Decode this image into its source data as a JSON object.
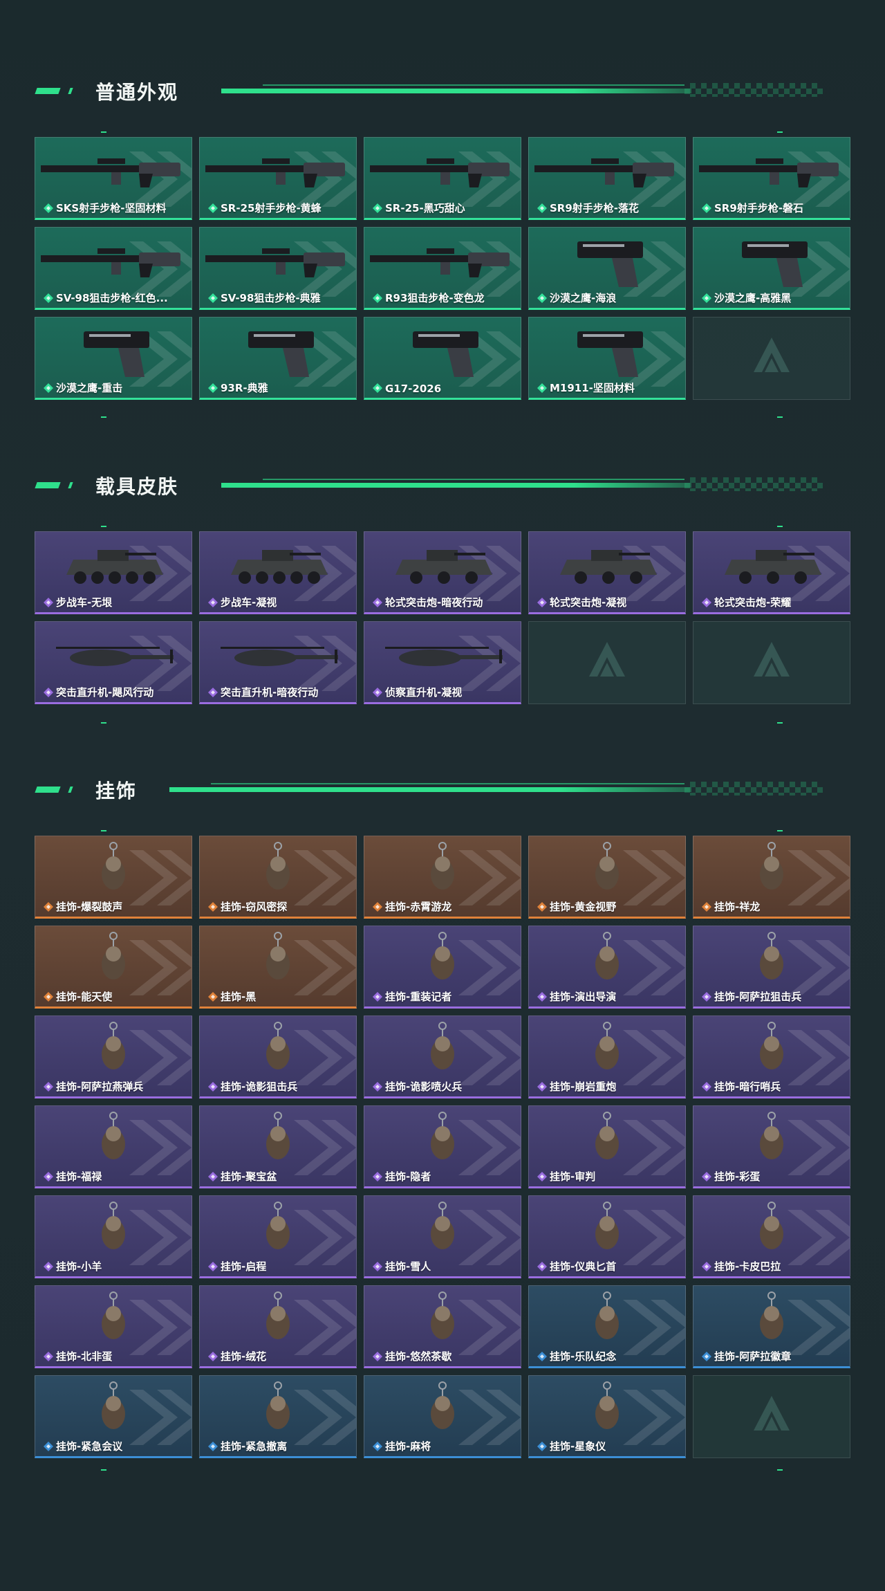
{
  "colors": {
    "accent": "#2fe08c",
    "green_rarity": "#33e29a",
    "purple_rarity": "#9a6de0",
    "orange_rarity": "#e0823a",
    "blue_rarity": "#3c8fd6"
  },
  "sections": [
    {
      "title": "普通外观",
      "items": [
        {
          "label": "SKS射手步枪-坚固材料",
          "rarity": "green",
          "icon": "rifle-icon"
        },
        {
          "label": "SR-25射手步枪-黄蜂",
          "rarity": "green",
          "icon": "rifle-icon"
        },
        {
          "label": "SR-25-黑巧甜心",
          "rarity": "green",
          "icon": "rifle-icon"
        },
        {
          "label": "SR9射手步枪-落花",
          "rarity": "green",
          "icon": "rifle-icon"
        },
        {
          "label": "SR9射手步枪-磐石",
          "rarity": "green",
          "icon": "rifle-icon"
        },
        {
          "label": "SV-98狙击步枪-红色...",
          "rarity": "green",
          "icon": "sniper-icon"
        },
        {
          "label": "SV-98狙击步枪-典雅",
          "rarity": "green",
          "icon": "sniper-icon"
        },
        {
          "label": "R93狙击步枪-变色龙",
          "rarity": "green",
          "icon": "sniper-icon"
        },
        {
          "label": "沙漠之鹰-海浪",
          "rarity": "green",
          "icon": "pistol-icon"
        },
        {
          "label": "沙漠之鹰-高雅黑",
          "rarity": "green",
          "icon": "pistol-icon"
        },
        {
          "label": "沙漠之鹰-重击",
          "rarity": "green",
          "icon": "pistol-icon"
        },
        {
          "label": "93R-典雅",
          "rarity": "green",
          "icon": "pistol-icon"
        },
        {
          "label": "G17-2026",
          "rarity": "green",
          "icon": "pistol-icon"
        },
        {
          "label": "M1911-坚固材料",
          "rarity": "green",
          "icon": "pistol-icon"
        },
        {
          "label": "",
          "rarity": "empty",
          "icon": "logo-icon"
        }
      ]
    },
    {
      "title": "载具皮肤",
      "items": [
        {
          "label": "步战车-无垠",
          "rarity": "purple",
          "icon": "ifv-icon"
        },
        {
          "label": "步战车-凝视",
          "rarity": "purple",
          "icon": "ifv-icon"
        },
        {
          "label": "轮式突击炮-暗夜行动",
          "rarity": "purple",
          "icon": "armored-car-icon"
        },
        {
          "label": "轮式突击炮-凝视",
          "rarity": "purple",
          "icon": "armored-car-icon"
        },
        {
          "label": "轮式突击炮-荣耀",
          "rarity": "purple",
          "icon": "armored-car-icon"
        },
        {
          "label": "突击直升机-飓风行动",
          "rarity": "purple",
          "icon": "helicopter-icon"
        },
        {
          "label": "突击直升机-暗夜行动",
          "rarity": "purple",
          "icon": "helicopter-icon"
        },
        {
          "label": "侦察直升机-凝视",
          "rarity": "purple",
          "icon": "helicopter-icon"
        },
        {
          "label": "",
          "rarity": "empty",
          "icon": "logo-icon"
        },
        {
          "label": "",
          "rarity": "empty",
          "icon": "logo-icon"
        }
      ]
    },
    {
      "title": "挂饰",
      "items": [
        {
          "label": "挂饰-爆裂鼓声",
          "rarity": "orange",
          "icon": "charm-icon"
        },
        {
          "label": "挂饰-窃风密探",
          "rarity": "orange",
          "icon": "charm-icon"
        },
        {
          "label": "挂饰-赤霄游龙",
          "rarity": "orange",
          "icon": "charm-icon"
        },
        {
          "label": "挂饰-黄金视野",
          "rarity": "orange",
          "icon": "charm-icon"
        },
        {
          "label": "挂饰-祥龙",
          "rarity": "orange",
          "icon": "charm-icon"
        },
        {
          "label": "挂饰-能天使",
          "rarity": "orange",
          "icon": "charm-icon"
        },
        {
          "label": "挂饰-黑",
          "rarity": "orange",
          "icon": "charm-icon"
        },
        {
          "label": "挂饰-重装记者",
          "rarity": "purple",
          "icon": "charm-icon"
        },
        {
          "label": "挂饰-演出导演",
          "rarity": "purple",
          "icon": "charm-icon"
        },
        {
          "label": "挂饰-阿萨拉狙击兵",
          "rarity": "purple",
          "icon": "charm-icon"
        },
        {
          "label": "挂饰-阿萨拉燕弹兵",
          "rarity": "purple",
          "icon": "charm-icon"
        },
        {
          "label": "挂饰-诡影狙击兵",
          "rarity": "purple",
          "icon": "charm-icon"
        },
        {
          "label": "挂饰-诡影喷火兵",
          "rarity": "purple",
          "icon": "charm-icon"
        },
        {
          "label": "挂饰-崩岩重炮",
          "rarity": "purple",
          "icon": "charm-icon"
        },
        {
          "label": "挂饰-暗行哨兵",
          "rarity": "purple",
          "icon": "charm-icon"
        },
        {
          "label": "挂饰-福禄",
          "rarity": "purple",
          "icon": "charm-icon"
        },
        {
          "label": "挂饰-聚宝盆",
          "rarity": "purple",
          "icon": "charm-icon"
        },
        {
          "label": "挂饰-隐者",
          "rarity": "purple",
          "icon": "charm-icon"
        },
        {
          "label": "挂饰-审判",
          "rarity": "purple",
          "icon": "charm-icon"
        },
        {
          "label": "挂饰-彩蛋",
          "rarity": "purple",
          "icon": "charm-icon"
        },
        {
          "label": "挂饰-小羊",
          "rarity": "purple",
          "icon": "charm-icon"
        },
        {
          "label": "挂饰-启程",
          "rarity": "purple",
          "icon": "charm-icon"
        },
        {
          "label": "挂饰-雪人",
          "rarity": "purple",
          "icon": "charm-icon"
        },
        {
          "label": "挂饰-仪典匕首",
          "rarity": "purple",
          "icon": "charm-icon"
        },
        {
          "label": "挂饰-卡皮巴拉",
          "rarity": "purple",
          "icon": "charm-icon"
        },
        {
          "label": "挂饰-北非蛋",
          "rarity": "purple",
          "icon": "charm-icon"
        },
        {
          "label": "挂饰-绒花",
          "rarity": "purple",
          "icon": "charm-icon"
        },
        {
          "label": "挂饰-悠然茶歇",
          "rarity": "purple",
          "icon": "charm-icon"
        },
        {
          "label": "挂饰-乐队纪念",
          "rarity": "blue",
          "icon": "charm-icon"
        },
        {
          "label": "挂饰-阿萨拉徽章",
          "rarity": "blue",
          "icon": "charm-icon"
        },
        {
          "label": "挂饰-紧急会议",
          "rarity": "blue",
          "icon": "charm-icon"
        },
        {
          "label": "挂饰-紧急撤离",
          "rarity": "blue",
          "icon": "charm-icon"
        },
        {
          "label": "挂饰-麻将",
          "rarity": "blue",
          "icon": "charm-icon"
        },
        {
          "label": "挂饰-星象仪",
          "rarity": "blue",
          "icon": "charm-icon"
        },
        {
          "label": "",
          "rarity": "empty",
          "icon": "logo-icon"
        }
      ]
    }
  ]
}
